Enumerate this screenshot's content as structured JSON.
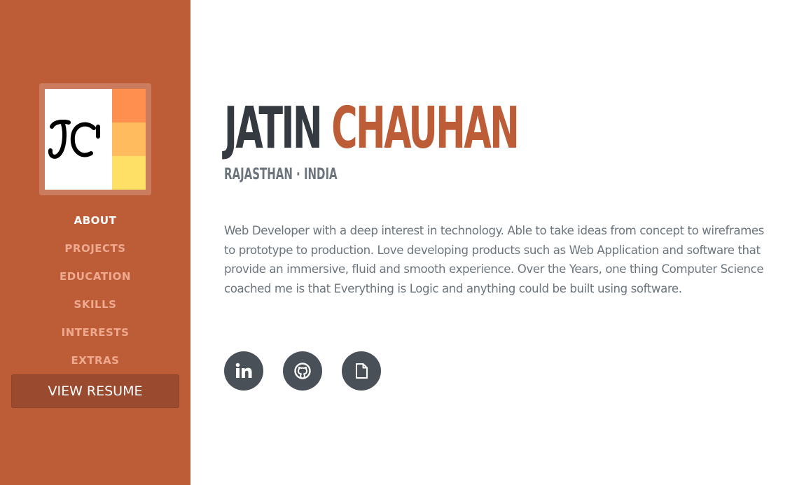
{
  "colors": {
    "sidebar_bg": "#bd5d38",
    "nav_active": "#ffffff",
    "nav_inactive": "#eea98f",
    "resume_text": "#ffffff",
    "first_name": "#343a40",
    "last_name": "#bd5d38",
    "location": "#6c757d",
    "stripe_1": "#ff8f4f",
    "stripe_2": "#ffbb5e",
    "stripe_3": "#ffe066",
    "logo_stroke": "#000000"
  },
  "sidebar": {
    "logo_icon": "jc-monogram-logo",
    "nav": [
      {
        "label": "ABOUT",
        "active": true
      },
      {
        "label": "PROJECTS",
        "active": false
      },
      {
        "label": "EDUCATION",
        "active": false
      },
      {
        "label": "SKILLS",
        "active": false
      },
      {
        "label": "INTERESTS",
        "active": false
      },
      {
        "label": "EXTRAS",
        "active": false
      }
    ],
    "resume_button": "VIEW RESUME"
  },
  "header": {
    "first_name": "JATIN",
    "last_name": "CHAUHAN",
    "location": "RAJASTHAN · INDIA"
  },
  "about": {
    "text": "Web Developer with a deep interest in technology. Able to take ideas from concept to wireframes to prototype to production. Love developing products such as Web Application and software that provide an immersive, fluid and smooth experience. Over the Years, one thing Computer Science coached me is that Everything is Logic and anything could be built using software."
  },
  "social": [
    {
      "icon": "linkedin-icon"
    },
    {
      "icon": "github-icon"
    },
    {
      "icon": "document-icon"
    }
  ]
}
